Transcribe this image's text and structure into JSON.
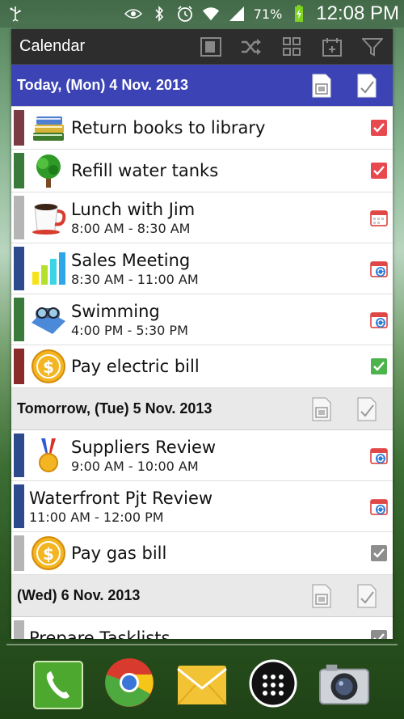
{
  "statusbar": {
    "battery": "71%",
    "time": "12:08 PM",
    "icons": [
      "usb-icon",
      "eye-icon",
      "bluetooth-icon",
      "alarm-icon",
      "wifi-icon",
      "signal-icon",
      "battery-icon"
    ]
  },
  "app": {
    "title": "Calendar",
    "toolbar_icons": [
      "view-toggle-icon",
      "shuffle-icon",
      "grid-icon",
      "calendar-add-icon",
      "filter-icon"
    ]
  },
  "colors": {
    "today_header": "#3b43b5",
    "other_header": "#e9e9e9",
    "maroon": "#7a3b45",
    "green": "#3a7a3a",
    "gray": "#b5b5b5",
    "blue": "#2d4a8c",
    "darkred": "#8a2a2a",
    "check_red": "#e8494f",
    "check_green": "#4db34d",
    "check_gray": "#8d8d8d"
  },
  "days": [
    {
      "title": "Today, (Mon) 4 Nov. 2013",
      "style": "today",
      "items": [
        {
          "title": "Return books to library",
          "time": "",
          "color": "maroon",
          "pic": "books-icon",
          "status": "checked-red"
        },
        {
          "title": "Refill water tanks",
          "time": "",
          "color": "green",
          "pic": "tree-icon",
          "status": "checked-red"
        },
        {
          "title": "Lunch with Jim",
          "time": "8:00 AM - 8:30 AM",
          "color": "gray",
          "pic": "coffee-cup-icon",
          "status": "calendar"
        },
        {
          "title": "Sales Meeting",
          "time": "8:30 AM - 11:00 AM",
          "color": "blue",
          "pic": "bar-chart-icon",
          "status": "calendar-sync"
        },
        {
          "title": "Swimming",
          "time": "4:00 PM - 5:30 PM",
          "color": "green",
          "pic": "goggles-icon",
          "status": "calendar-sync"
        },
        {
          "title": "Pay electric bill",
          "time": "",
          "color": "darkred",
          "pic": "dollar-coin-icon",
          "status": "checked-green"
        }
      ]
    },
    {
      "title": "Tomorrow, (Tue) 5 Nov. 2013",
      "style": "other",
      "items": [
        {
          "title": "Suppliers Review",
          "time": "9:00 AM - 10:00 AM",
          "color": "blue",
          "pic": "medal-icon",
          "status": "calendar-sync"
        },
        {
          "title": "Waterfront Pjt Review",
          "time": "11:00 AM - 12:00 PM",
          "color": "blue",
          "pic": "",
          "status": "calendar-sync"
        },
        {
          "title": "Pay gas bill",
          "time": "",
          "color": "gray",
          "pic": "dollar-coin-icon",
          "status": "checked-gray"
        }
      ]
    },
    {
      "title": "(Wed) 6 Nov. 2013",
      "style": "other",
      "items": [
        {
          "title": "Prepare Tasklists",
          "time": "",
          "color": "gray",
          "pic": "",
          "status": "checked-gray"
        }
      ]
    }
  ],
  "dock": [
    "phone-icon",
    "chrome-icon",
    "email-icon",
    "apps-icon",
    "camera-icon"
  ]
}
